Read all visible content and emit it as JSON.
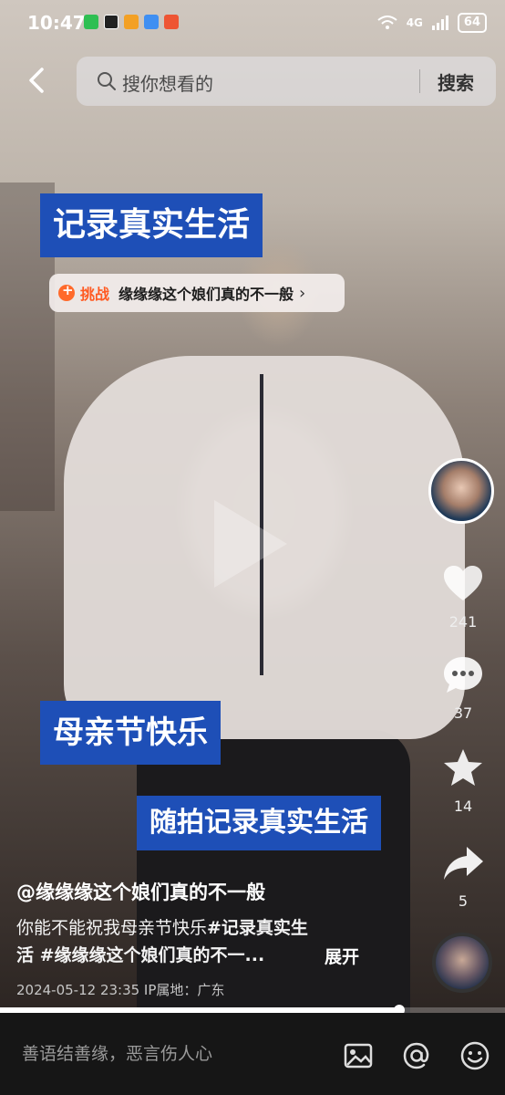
{
  "status_bar": {
    "time": "10:47",
    "network": "4G",
    "battery": "64"
  },
  "search": {
    "placeholder": "搜你想看的",
    "button": "搜索"
  },
  "captions": {
    "top": "记录真实生活",
    "middle": "母亲节快乐",
    "bottom": "随拍记录真实生活"
  },
  "challenge": {
    "tag": "挑战",
    "name": "缘缘缘这个娘们真的不一般"
  },
  "actions": {
    "likes": "241",
    "comments": "37",
    "favorites": "14",
    "shares": "5"
  },
  "post": {
    "author": "@缘缘缘这个娘们真的不一般",
    "desc_line1_plain": "你能不能祝我母亲节快乐",
    "desc_line1_tag": "#记录真实生",
    "desc_line2": "活 #缘缘缘这个娘们真的不一...",
    "expand": "展开",
    "meta": "2024-05-12 23:35  IP属地：广东"
  },
  "playback": {
    "progress": 0.79
  },
  "comment_bar": {
    "placeholder": "善语结善缘，恶言伤人心"
  },
  "colors": {
    "caption_bg": "#1e4fb7",
    "challenge_accent": "#ff5a22"
  }
}
